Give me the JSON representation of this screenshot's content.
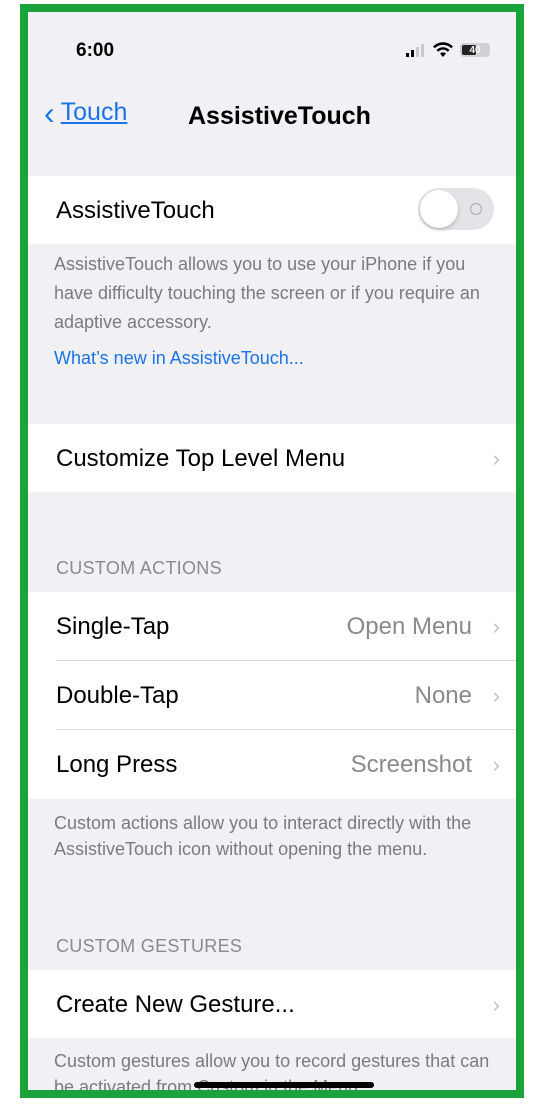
{
  "status_bar": {
    "time": "6:00",
    "signal_icon": "signal-bars-icon",
    "wifi_icon": "wifi-icon",
    "battery_level": "40"
  },
  "nav": {
    "back_label": "Touch",
    "title": "AssistiveTouch"
  },
  "assistive_touch": {
    "label": "AssistiveTouch",
    "toggle_on": false,
    "description": "AssistiveTouch allows you to use your iPhone if you have difficulty touching the screen or if you require an adaptive accessory.",
    "link": "What’s new in AssistiveTouch..."
  },
  "customize_menu": {
    "label": "Customize Top Level Menu"
  },
  "custom_actions": {
    "header": "CUSTOM ACTIONS",
    "rows": [
      {
        "label": "Single-Tap",
        "value": "Open Menu"
      },
      {
        "label": "Double-Tap",
        "value": "None"
      },
      {
        "label": "Long Press",
        "value": "Screenshot"
      }
    ],
    "footer": "Custom actions allow you to interact directly with the AssistiveTouch icon without opening the menu."
  },
  "custom_gestures": {
    "header": "CUSTOM GESTURES",
    "create_label": "Create New Gesture...",
    "footer": "Custom gestures allow you to record gestures that can be activated from Custom in the Menu."
  },
  "colors": {
    "frame_border": "#19a33a",
    "accent": "#1a73e8",
    "background": "#f0f0f5"
  }
}
